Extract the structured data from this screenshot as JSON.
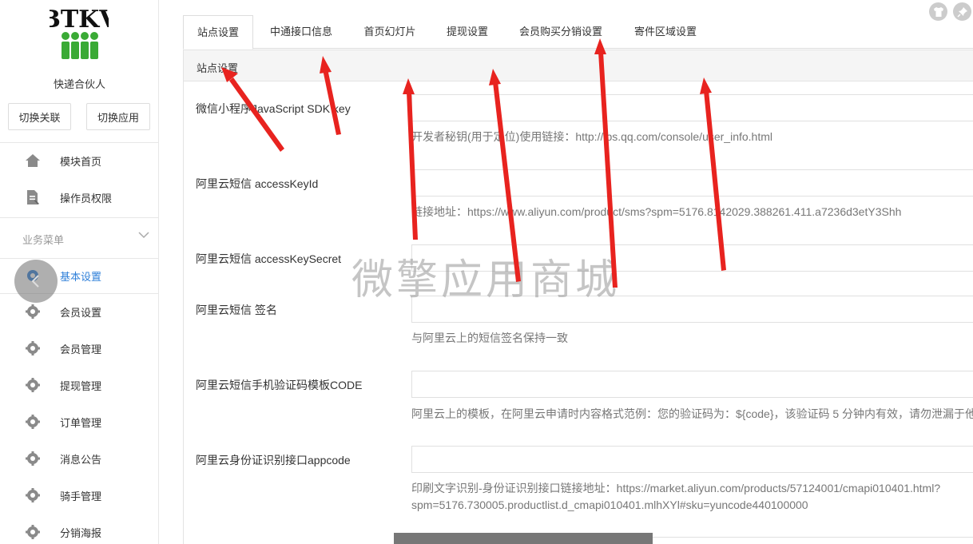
{
  "sidebar": {
    "app_name": "快递合伙人",
    "buttons": {
      "switch_link": "切换关联",
      "switch_app": "切换应用"
    },
    "top_items": [
      {
        "label": "模块首页",
        "icon": "home-icon"
      },
      {
        "label": "操作员权限",
        "icon": "document-edit-icon"
      }
    ],
    "section_title": "业务菜单",
    "items": [
      {
        "label": "基本设置",
        "icon": "gear-icon",
        "active": true
      },
      {
        "label": "会员设置",
        "icon": "gear-icon"
      },
      {
        "label": "会员管理",
        "icon": "gear-icon"
      },
      {
        "label": "提现管理",
        "icon": "gear-icon"
      },
      {
        "label": "订单管理",
        "icon": "gear-icon"
      },
      {
        "label": "消息公告",
        "icon": "gear-icon"
      },
      {
        "label": "骑手管理",
        "icon": "gear-icon"
      },
      {
        "label": "分销海报",
        "icon": "gear-icon"
      }
    ]
  },
  "tabs": [
    {
      "label": "站点设置",
      "active": true
    },
    {
      "label": "中通接口信息"
    },
    {
      "label": "首页幻灯片"
    },
    {
      "label": "提现设置"
    },
    {
      "label": "会员购买分销设置"
    },
    {
      "label": "寄件区域设置"
    }
  ],
  "panel": {
    "title": "站点设置",
    "fields": [
      {
        "label": "微信小程序JavaScript SDK key",
        "value": "",
        "help": "开发者秘钥(用于定位)使用链接：http://lbs.qq.com/console/user_info.html"
      },
      {
        "label": "阿里云短信 accessKeyId",
        "value": "",
        "help": "链接地址：https://www.aliyun.com/product/sms?spm=5176.8142029.388261.411.a7236d3etY3Shh"
      },
      {
        "label": "阿里云短信 accessKeySecret",
        "value": "",
        "help": ""
      },
      {
        "label": "阿里云短信 签名",
        "value": "",
        "help": "与阿里云上的短信签名保持一致"
      },
      {
        "label": "阿里云短信手机验证码模板CODE",
        "value": "",
        "help": "阿里云上的模板，在阿里云申请时内容格式范例：您的验证码为：${code}，该验证码 5 分钟内有效，请勿泄漏于他"
      },
      {
        "label": "阿里云身份证识别接口appcode",
        "value": "",
        "help": "印刷文字识别-身份证识别接口链接地址：https://market.aliyun.com/products/57124001/cmapi010401.html?",
        "help2": "spm=5176.730005.productlist.d_cmapi010401.mlhXYl#sku=yuncode440100000"
      }
    ]
  },
  "watermark": "微擎应用商城",
  "colors": {
    "accent": "#2e7fd9",
    "arrow": "#e8231f",
    "logo_green": "#3aaa35"
  }
}
